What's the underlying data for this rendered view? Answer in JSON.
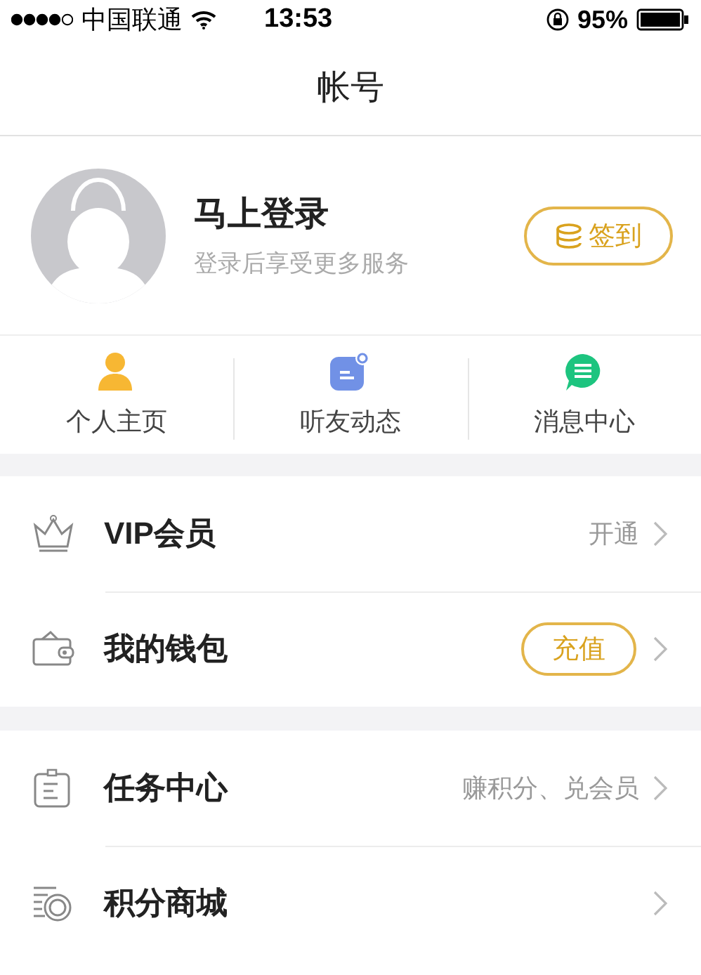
{
  "status_bar": {
    "carrier": "中国联通",
    "time": "13:53",
    "battery": "95%"
  },
  "nav": {
    "title": "帐号"
  },
  "profile": {
    "name": "马上登录",
    "subtitle": "登录后享受更多服务",
    "checkin": "签到"
  },
  "shortcuts": [
    {
      "label": "个人主页"
    },
    {
      "label": "听友动态"
    },
    {
      "label": "消息中心"
    }
  ],
  "menu_groups": [
    [
      {
        "label": "VIP会员",
        "kind": "text",
        "detail": "开通"
      },
      {
        "label": "我的钱包",
        "kind": "button",
        "detail": "充值"
      }
    ],
    [
      {
        "label": "任务中心",
        "kind": "text",
        "detail": "赚积分、兑会员"
      },
      {
        "label": "积分商城",
        "kind": "none"
      }
    ]
  ]
}
